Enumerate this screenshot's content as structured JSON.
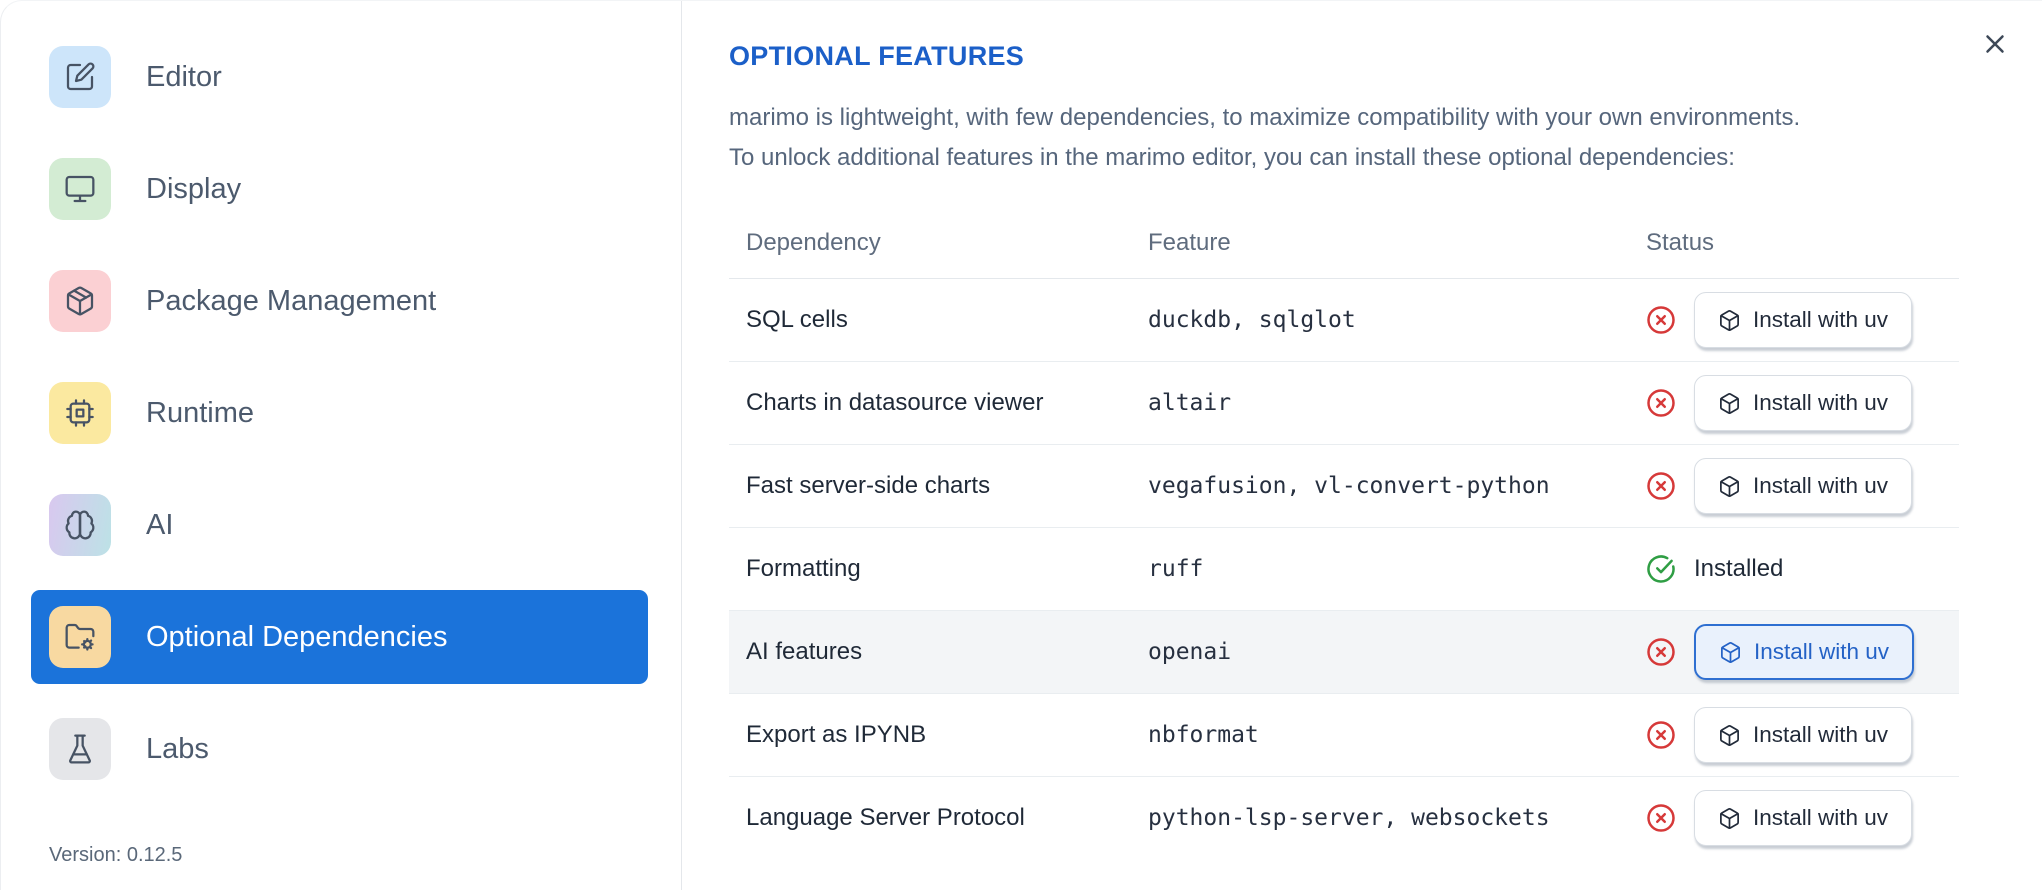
{
  "sidebar": {
    "items": [
      {
        "label": "Editor",
        "icon": "square-pen-icon",
        "tile_style": "background:#cde5fa"
      },
      {
        "label": "Display",
        "icon": "monitor-icon",
        "tile_style": "background:#d3ecd3"
      },
      {
        "label": "Package Management",
        "icon": "package-icon",
        "tile_style": "background:#fbd0d3"
      },
      {
        "label": "Runtime",
        "icon": "cpu-icon",
        "tile_style": "background:#fbe9a0"
      },
      {
        "label": "AI",
        "icon": "brain-icon",
        "tile_style": "background:linear-gradient(100deg,#d9c8ef,#bce2e6)"
      },
      {
        "label": "Optional Dependencies",
        "icon": "folder-cog-icon",
        "tile_style": "background:#f8d9a1",
        "selected": true
      },
      {
        "label": "Labs",
        "icon": "flask-icon",
        "tile_style": "background:#e5e6e9"
      }
    ],
    "version_label": "Version: 0.12.5"
  },
  "panel": {
    "title": "OPTIONAL FEATURES",
    "description_line1": "marimo is lightweight, with few dependencies, to maximize compatibility with your own environments.",
    "description_line2": "To unlock additional features in the marimo editor, you can install these optional dependencies:",
    "table": {
      "columns": {
        "dependency": "Dependency",
        "feature": "Feature",
        "status": "Status"
      },
      "rows": [
        {
          "dependency": "SQL cells",
          "feature": "duckdb, sqlglot",
          "status": "missing",
          "status_icon": "circle-x-icon",
          "action": "Install with uv"
        },
        {
          "dependency": "Charts in datasource viewer",
          "feature": "altair",
          "status": "missing",
          "status_icon": "circle-x-icon",
          "action": "Install with uv"
        },
        {
          "dependency": "Fast server-side charts",
          "feature": "vegafusion, vl-convert-python",
          "status": "missing",
          "status_icon": "circle-x-icon",
          "action": "Install with uv"
        },
        {
          "dependency": "Formatting",
          "feature": "ruff",
          "status": "installed",
          "status_icon": "circle-check-icon",
          "status_label": "Installed"
        },
        {
          "dependency": "AI features",
          "feature": "openai",
          "status": "missing",
          "status_icon": "circle-x-icon",
          "action": "Install with uv",
          "highlighted": true
        },
        {
          "dependency": "Export as IPYNB",
          "feature": "nbformat",
          "status": "missing",
          "status_icon": "circle-x-icon",
          "action": "Install with uv"
        },
        {
          "dependency": "Language Server Protocol",
          "feature": "python-lsp-server, websockets",
          "status": "missing",
          "status_icon": "circle-x-icon",
          "action": "Install with uv"
        }
      ]
    }
  },
  "colors": {
    "sidebar_selected_blue": "#1b73da",
    "title_blue": "#1b5fc8",
    "error_red": "#d63939",
    "success_green": "#2f9e44",
    "row_highlight": "#f3f5f7",
    "focus_button_border": "#2e6fd1",
    "focus_button_bg": "#e9f1fc"
  }
}
